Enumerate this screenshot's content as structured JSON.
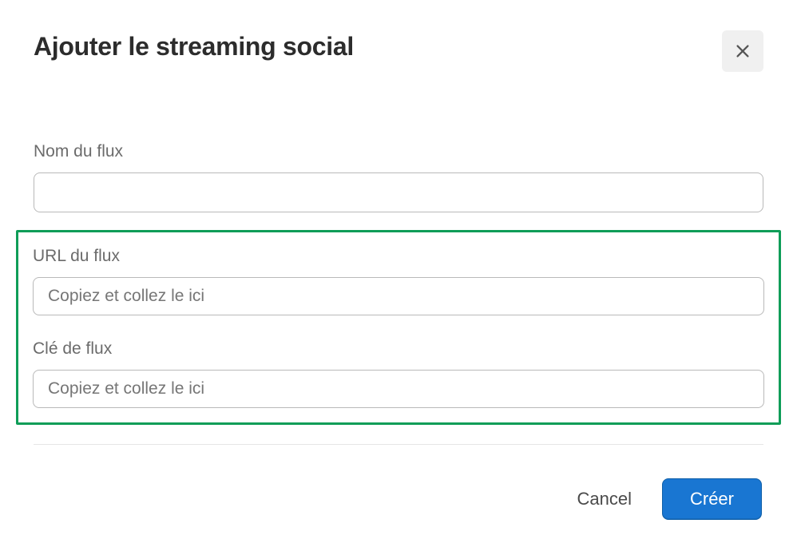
{
  "dialog": {
    "title": "Ajouter le streaming social"
  },
  "fields": {
    "streamName": {
      "label": "Nom du flux",
      "value": "",
      "placeholder": ""
    },
    "streamUrl": {
      "label": "URL du flux",
      "value": "",
      "placeholder": "Copiez et collez le ici"
    },
    "streamKey": {
      "label": "Clé de flux",
      "value": "",
      "placeholder": "Copiez et collez le ici"
    }
  },
  "footer": {
    "cancelLabel": "Cancel",
    "createLabel": "Créer"
  }
}
